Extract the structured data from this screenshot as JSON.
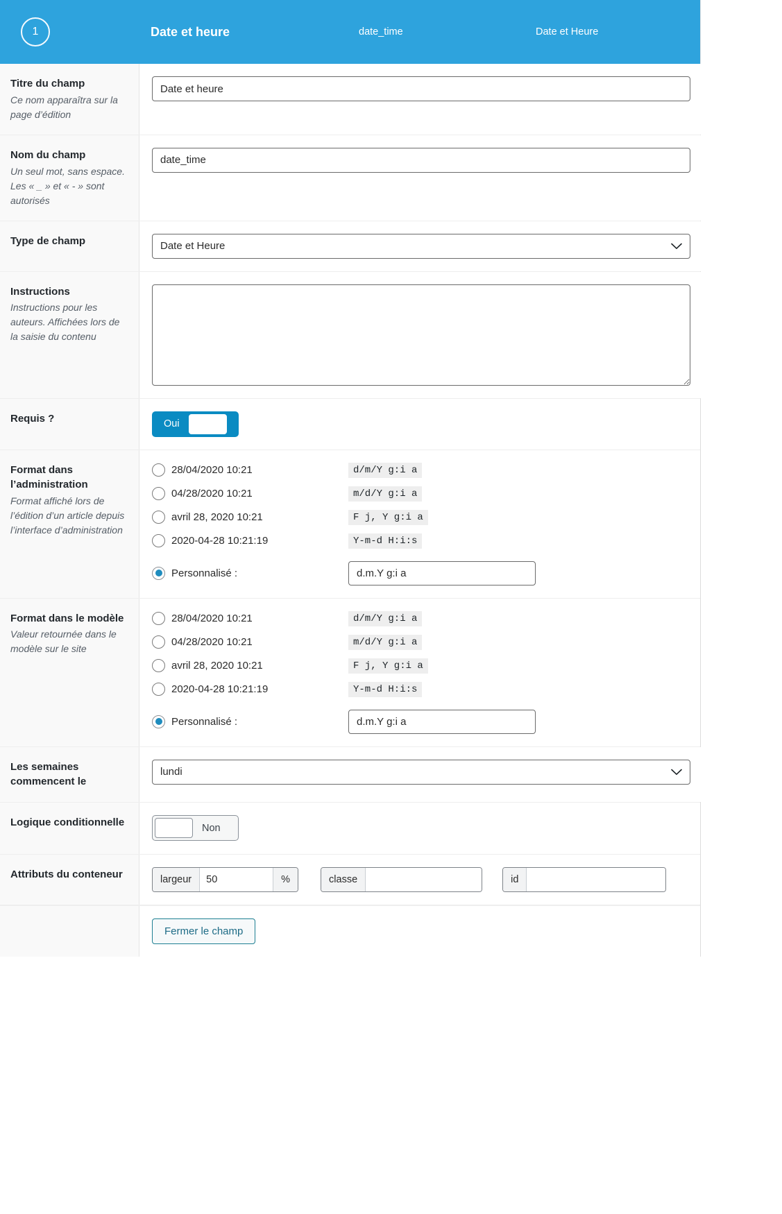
{
  "header": {
    "order_number": "1",
    "field_label": "Date et heure",
    "field_name": "date_time",
    "field_type": "Date et Heure",
    "accent_color": "#2ea3dd"
  },
  "rows": {
    "label": {
      "title": "Titre du champ",
      "desc": "Ce nom apparaîtra sur la page d’édition",
      "value": "Date et heure"
    },
    "name": {
      "title": "Nom du champ",
      "desc": "Un seul mot, sans espace.\nLes « _ » et « - » sont autorisés",
      "value": "date_time"
    },
    "type": {
      "title": "Type de champ",
      "value": "Date et Heure",
      "options": [
        "Date et Heure"
      ]
    },
    "instructions": {
      "title": "Instructions",
      "desc": "Instructions pour les auteurs. Affichées lors de la saisie du contenu",
      "value": ""
    },
    "required": {
      "title": "Requis ?",
      "toggle_label": "Oui",
      "state": "on"
    },
    "admin_format": {
      "title": "Format dans l’administration",
      "desc": "Format affiché lors de l’édition d’un article depuis l’interface d’administration",
      "options": [
        {
          "label": "28/04/2020 10:21",
          "code": "d/m/Y g:i a",
          "selected": false
        },
        {
          "label": "04/28/2020 10:21",
          "code": "m/d/Y g:i a",
          "selected": false
        },
        {
          "label": "avril 28, 2020 10:21",
          "code": "F j, Y g:i a",
          "selected": false
        },
        {
          "label": "2020-04-28 10:21:19",
          "code": "Y-m-d H:i:s",
          "selected": false
        }
      ],
      "custom_label": "Personnalisé :",
      "custom_selected": true,
      "custom_value": "d.m.Y g:i a"
    },
    "template_format": {
      "title": "Format dans le modèle",
      "desc": "Valeur retournée dans le modèle sur le site",
      "options": [
        {
          "label": "28/04/2020 10:21",
          "code": "d/m/Y g:i a",
          "selected": false
        },
        {
          "label": "04/28/2020 10:21",
          "code": "m/d/Y g:i a",
          "selected": false
        },
        {
          "label": "avril 28, 2020 10:21",
          "code": "F j, Y g:i a",
          "selected": false
        },
        {
          "label": "2020-04-28 10:21:19",
          "code": "Y-m-d H:i:s",
          "selected": false
        }
      ],
      "custom_label": "Personnalisé :",
      "custom_selected": true,
      "custom_value": "d.m.Y g:i a"
    },
    "week_start": {
      "title": "Les semaines commencent le",
      "value": "lundi",
      "options": [
        "lundi"
      ]
    },
    "conditional": {
      "title": "Logique conditionnelle",
      "toggle_label": "Non",
      "state": "off"
    },
    "wrapper": {
      "title": "Attributs du conteneur",
      "width_addon": "largeur",
      "width_value": "50",
      "percent_addon": "%",
      "class_addon": "classe",
      "class_value": "",
      "id_addon": "id",
      "id_value": ""
    }
  },
  "footer": {
    "close_label": "Fermer le champ"
  }
}
